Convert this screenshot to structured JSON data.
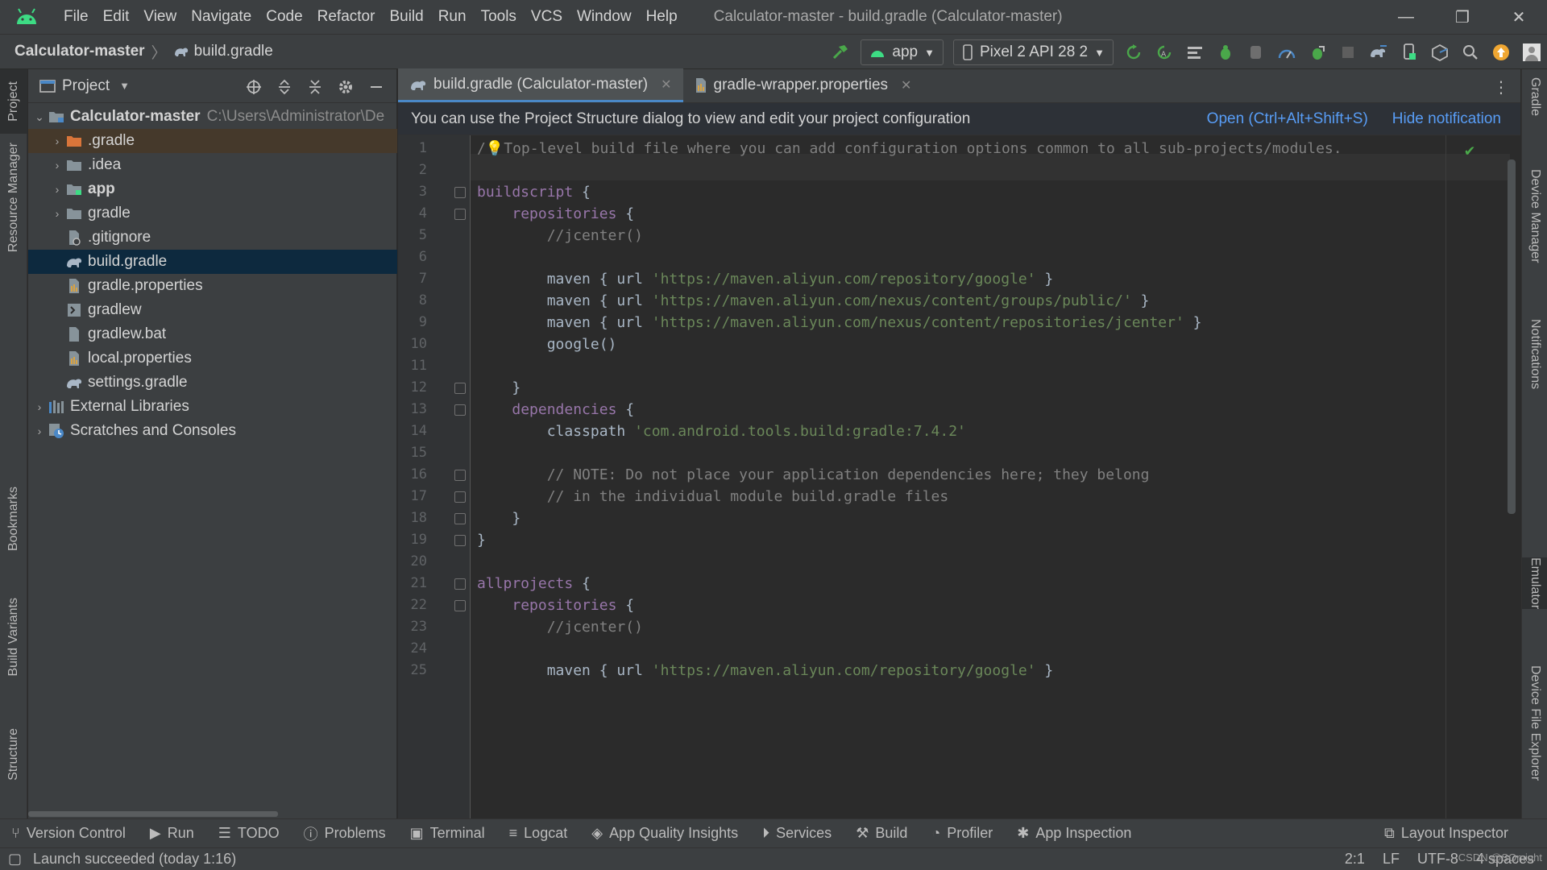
{
  "window": {
    "title": "Calculator-master - build.gradle (Calculator-master)",
    "controls": [
      "—",
      "❐",
      "✕"
    ]
  },
  "menu": [
    "File",
    "Edit",
    "View",
    "Navigate",
    "Code",
    "Refactor",
    "Build",
    "Run",
    "Tools",
    "VCS",
    "Window",
    "Help"
  ],
  "breadcrumb": {
    "project": "Calculator-master",
    "file": "build.gradle"
  },
  "toolbar": {
    "run_config": "app",
    "device": "Pixel 2 API 28 2"
  },
  "left_tabs": [
    "Project",
    "Resource Manager",
    "Bookmarks",
    "Build Variants",
    "Structure"
  ],
  "right_tabs": [
    "Gradle",
    "Device Manager",
    "Notifications",
    "Emulator",
    "Device File Explorer"
  ],
  "project_panel": {
    "title": "Project",
    "root": {
      "name": "Calculator-master",
      "path": "C:\\Users\\Administrator\\De"
    },
    "items": [
      {
        "name": ".gradle",
        "type": "folder-orange",
        "expandable": true
      },
      {
        "name": ".idea",
        "type": "folder",
        "expandable": true
      },
      {
        "name": "app",
        "type": "module",
        "expandable": true
      },
      {
        "name": "gradle",
        "type": "folder",
        "expandable": true
      },
      {
        "name": ".gitignore",
        "type": "file"
      },
      {
        "name": "build.gradle",
        "type": "gradle"
      },
      {
        "name": "gradle.properties",
        "type": "properties"
      },
      {
        "name": "gradlew",
        "type": "script"
      },
      {
        "name": "gradlew.bat",
        "type": "file"
      },
      {
        "name": "local.properties",
        "type": "properties"
      },
      {
        "name": "settings.gradle",
        "type": "gradle"
      }
    ],
    "external": "External Libraries",
    "scratches": "Scratches and Consoles"
  },
  "editor": {
    "tabs": [
      {
        "label": "build.gradle (Calculator-master)",
        "active": true
      },
      {
        "label": "gradle-wrapper.properties",
        "active": false
      }
    ],
    "notification": {
      "text": "You can use the Project Structure dialog to view and edit your project configuration",
      "link_open": "Open (Ctrl+Alt+Shift+S)",
      "link_hide": "Hide notification"
    },
    "lines": [
      "/💡Top-level build file where you can add configuration options common to all sub-projects/modules.",
      "",
      "buildscript {",
      "    repositories {",
      "        //jcenter()",
      "",
      "        maven { url 'https://maven.aliyun.com/repository/google' }",
      "        maven { url 'https://maven.aliyun.com/nexus/content/groups/public/' }",
      "        maven { url 'https://maven.aliyun.com/nexus/content/repositories/jcenter' }",
      "        google()",
      "",
      "    }",
      "    dependencies {",
      "        classpath 'com.android.tools.build:gradle:7.4.2'",
      "",
      "        // NOTE: Do not place your application dependencies here; they belong",
      "        // in the individual module build.gradle files",
      "    }",
      "}",
      "",
      "allprojects {",
      "    repositories {",
      "        //jcenter()",
      "",
      "        maven { url 'https://maven.aliyun.com/repository/google' }"
    ]
  },
  "bottom_tools": [
    "Version Control",
    "Run",
    "TODO",
    "Problems",
    "Terminal",
    "Logcat",
    "App Quality Insights",
    "Services",
    "Build",
    "Profiler",
    "App Inspection"
  ],
  "layout_inspector": "Layout Inspector",
  "status": {
    "message": "Launch succeeded (today 1:16)",
    "position": "2:1",
    "line_sep": "LF",
    "encoding": "UTF-8",
    "indent": "4 spaces",
    "watermark": "CSDN @SQmight"
  },
  "colors": {
    "keyword": "#9876aa",
    "string": "#6a8759",
    "comment": "#808080",
    "link": "#589df6",
    "selection": "#0d293e"
  }
}
